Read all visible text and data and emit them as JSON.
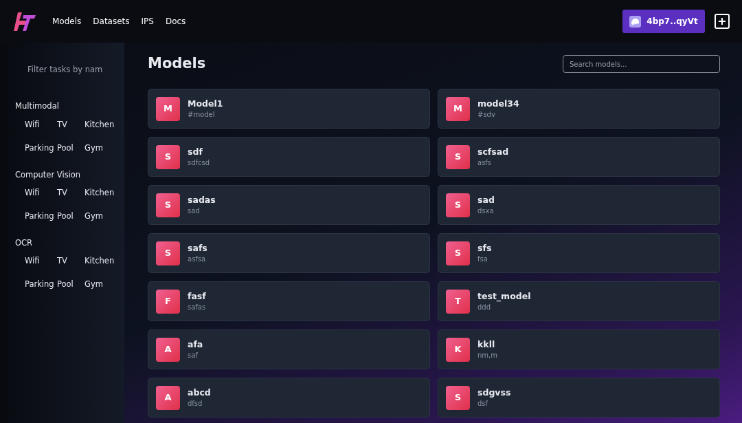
{
  "nav": {
    "links": [
      "Models",
      "Datasets",
      "IPS",
      "Docs"
    ]
  },
  "wallet": {
    "label": "4bp7..qyVt"
  },
  "sidebar": {
    "filter_placeholder": "Filter tasks by nam",
    "categories": [
      {
        "name": "Multimodal",
        "tags": [
          "Wifi",
          "TV",
          "Kitchen",
          "Parking",
          "Pool",
          "Gym"
        ]
      },
      {
        "name": "Computer Vision",
        "tags": [
          "Wifi",
          "TV",
          "Kitchen",
          "Parking",
          "Pool",
          "Gym"
        ]
      },
      {
        "name": "OCR",
        "tags": [
          "Wifi",
          "TV",
          "Kitchen",
          "Parking",
          "Pool",
          "Gym"
        ]
      }
    ]
  },
  "page": {
    "title": "Models",
    "search_placeholder": "Search models..."
  },
  "models": [
    {
      "initial": "M",
      "name": "Model1",
      "tag": "#model"
    },
    {
      "initial": "M",
      "name": "model34",
      "tag": "#sdv"
    },
    {
      "initial": "S",
      "name": "sdf",
      "tag": "sdfcsd"
    },
    {
      "initial": "S",
      "name": "scfsad",
      "tag": "asfs"
    },
    {
      "initial": "S",
      "name": "sadas",
      "tag": "sad"
    },
    {
      "initial": "S",
      "name": "sad",
      "tag": "dsxa"
    },
    {
      "initial": "S",
      "name": "safs",
      "tag": "asfsa"
    },
    {
      "initial": "S",
      "name": "sfs",
      "tag": "fsa"
    },
    {
      "initial": "F",
      "name": "fasf",
      "tag": "safas"
    },
    {
      "initial": "T",
      "name": "test_model",
      "tag": "ddd"
    },
    {
      "initial": "A",
      "name": "afa",
      "tag": "saf"
    },
    {
      "initial": "K",
      "name": "kkll",
      "tag": "nm,m"
    },
    {
      "initial": "A",
      "name": "abcd",
      "tag": "dfsd"
    },
    {
      "initial": "S",
      "name": "sdgvss",
      "tag": "dsf"
    }
  ]
}
